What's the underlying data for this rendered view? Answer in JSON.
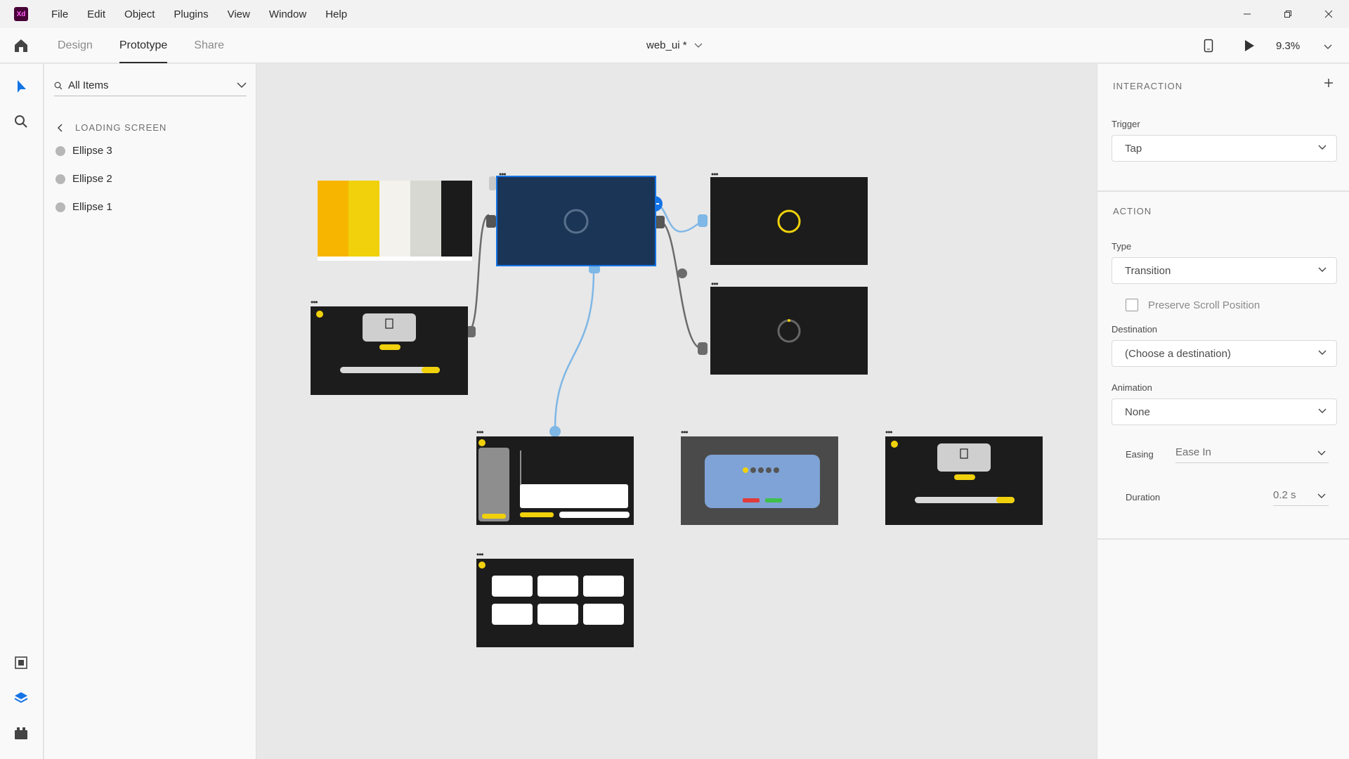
{
  "app": {
    "logo_text": "Xd",
    "menu": [
      "File",
      "Edit",
      "Object",
      "Plugins",
      "View",
      "Window",
      "Help"
    ]
  },
  "toolbar": {
    "tabs": [
      "Design",
      "Prototype",
      "Share"
    ],
    "active_tab": "Prototype",
    "doc_title": "web_ui *",
    "zoom": "9.3%"
  },
  "layers": {
    "filter": "All Items",
    "breadcrumb": "LOADING SCREEN",
    "items": [
      "Ellipse 3",
      "Ellipse 2",
      "Ellipse 1"
    ]
  },
  "canvas": {
    "palette_colors": [
      "#f7b500",
      "#f0d10c",
      "#f4f2ec",
      "#d7d8d2",
      "#1b1b1b"
    ]
  },
  "interaction": {
    "header": "INTERACTION",
    "trigger_label": "Trigger",
    "trigger_value": "Tap"
  },
  "action": {
    "header": "ACTION",
    "type_label": "Type",
    "type_value": "Transition",
    "preserve_scroll_label": "Preserve Scroll Position",
    "preserve_scroll_checked": false,
    "destination_label": "Destination",
    "destination_value": "(Choose a destination)",
    "animation_label": "Animation",
    "animation_value": "None",
    "easing_label": "Easing",
    "easing_value": "Ease In",
    "duration_label": "Duration",
    "duration_value": "0.2 s"
  },
  "colors": {
    "accent": "#1473e6",
    "selected_artboard": "#1b3557",
    "wire_blue": "#7fb7e6",
    "wire_gray": "#6b6b6b",
    "brand_yellow": "#f0d10c"
  }
}
